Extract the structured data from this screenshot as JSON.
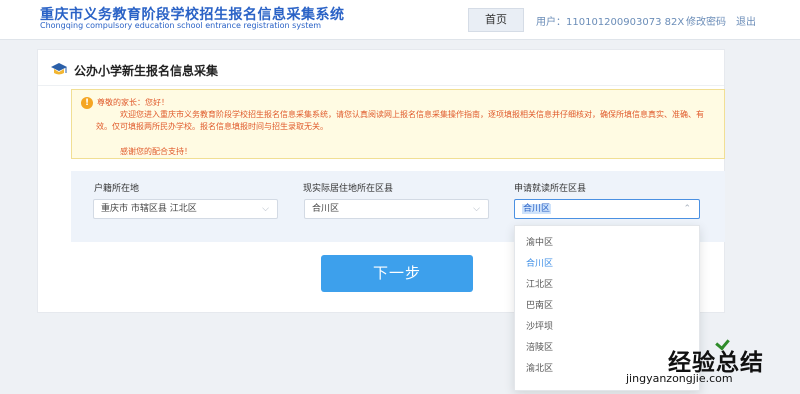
{
  "header": {
    "title_cn": "重庆市义务教育阶段学校招生报名信息采集系统",
    "title_en": "Chongqing compulsory education school entrance registration system",
    "home_label": "首页",
    "user_label": "用户：110101200903073 82X",
    "change_password_label": "修改密码",
    "logout_label": "退出"
  },
  "card": {
    "title": "公办小学新生报名信息采集"
  },
  "notice": {
    "greeting": "尊敬的家长：您好！",
    "body": "欢迎您进入重庆市义务教育阶段学校招生报名信息采集系统，请您认真阅读网上报名信息采集操作指南，逐项填报相关信息并仔细核对，确保所填信息真实、准确、有效。仅可填报两所民办学校。报名信息填报时间与招生录取无关。",
    "thanks": "感谢您的配合支持！"
  },
  "form": {
    "household_label": "户籍所在地",
    "household_value": "重庆市  市辖区县  江北区",
    "residence_label": "现实际居住地所在区县",
    "residence_value": "合川区",
    "apply_label": "申请就读所在区县",
    "apply_value": "合川区"
  },
  "next_button_label": "下一步",
  "dropdown": {
    "options": [
      "渝中区",
      "合川区",
      "江北区",
      "巴南区",
      "沙坪坝",
      "涪陵区",
      "渝北区"
    ],
    "selected": "合川区"
  },
  "watermark": {
    "text_cn": "经验总结",
    "text_en": "jingyanzongjie.com"
  },
  "colors": {
    "brand": "#2a62c6",
    "primary_button": "#3da0ec",
    "notice_text": "#e05a2b",
    "selected_option": "#3d8ee6"
  }
}
